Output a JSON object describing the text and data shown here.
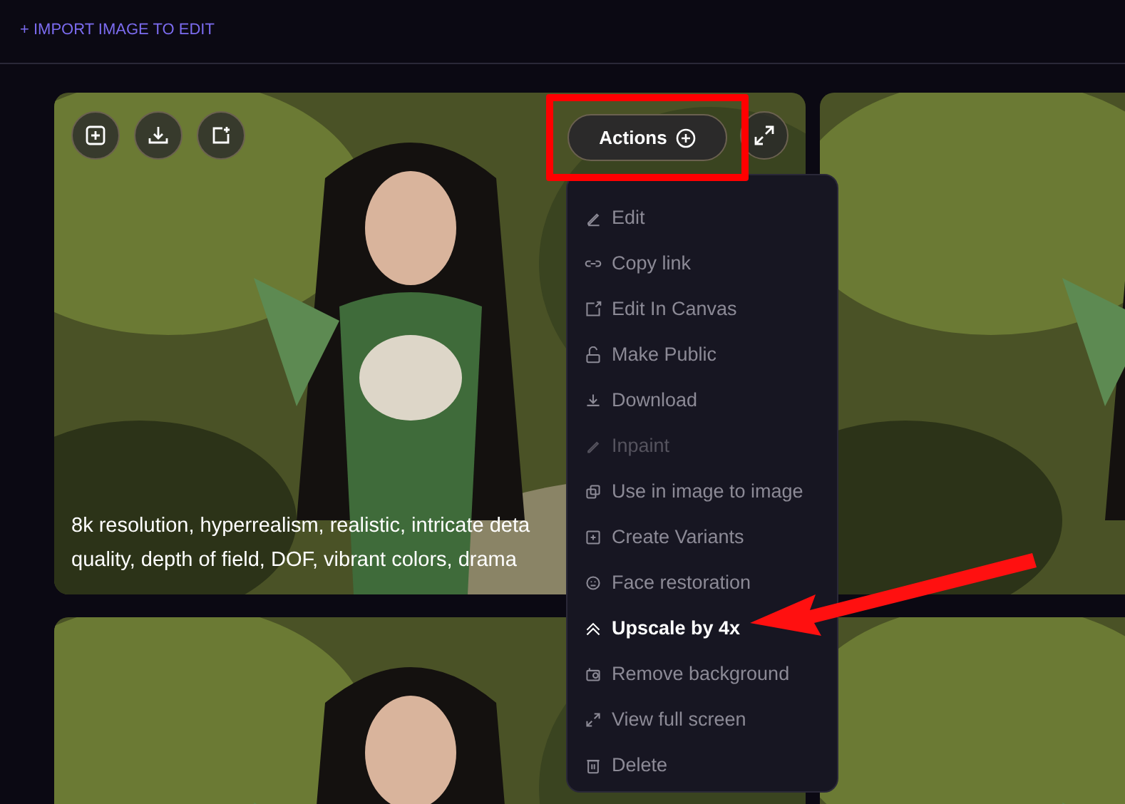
{
  "header": {
    "import_link": "+ IMPORT IMAGE TO EDIT"
  },
  "cards": [
    {
      "kind": "picture",
      "caption_lines": [
        "8k resolution, hyperrealism, realistic, intricate deta",
        "quality, depth of field, DOF, vibrant colors, drama"
      ],
      "toolbar": true
    },
    {
      "kind": "picture"
    },
    {
      "kind": "picture"
    },
    {
      "kind": "picture"
    }
  ],
  "actions_button": {
    "label": "Actions"
  },
  "menu": [
    {
      "label": "Edit",
      "disabled": false,
      "selected": false
    },
    {
      "label": "Copy link",
      "disabled": false,
      "selected": false
    },
    {
      "label": "Edit In Canvas",
      "disabled": false,
      "selected": false
    },
    {
      "label": "Make Public",
      "disabled": false,
      "selected": false
    },
    {
      "label": "Download",
      "disabled": false,
      "selected": false
    },
    {
      "label": "Inpaint",
      "disabled": true,
      "selected": false
    },
    {
      "label": "Use in image to image",
      "disabled": false,
      "selected": false
    },
    {
      "label": "Create Variants",
      "disabled": false,
      "selected": false
    },
    {
      "label": "Face restoration",
      "disabled": false,
      "selected": false
    },
    {
      "label": "Upscale by 4x",
      "disabled": false,
      "selected": true
    },
    {
      "label": "Remove background",
      "disabled": false,
      "selected": false
    },
    {
      "label": "View full screen",
      "disabled": false,
      "selected": false
    },
    {
      "label": "Delete",
      "disabled": false,
      "selected": false
    }
  ]
}
